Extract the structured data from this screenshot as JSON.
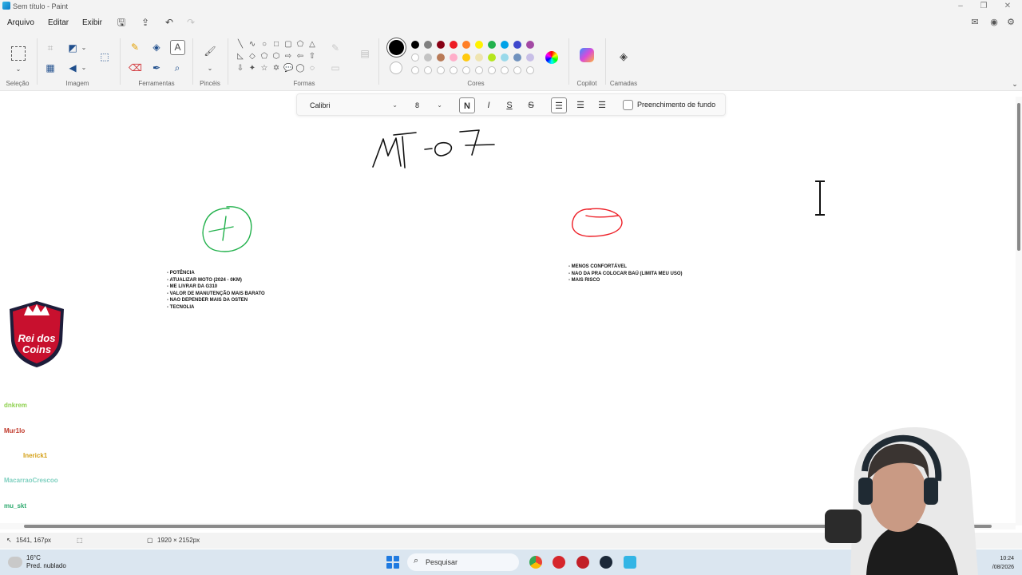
{
  "window": {
    "title": "Sem título - Paint"
  },
  "menu": {
    "items": [
      "Arquivo",
      "Editar",
      "Exibir"
    ]
  },
  "ribbon": {
    "groups": {
      "selecao": "Seleção",
      "imagem": "Imagem",
      "ferramentas": "Ferramentas",
      "pinceis": "Pincéis",
      "formas": "Formas",
      "cores": "Cores",
      "copilot": "Copilot",
      "camadas": "Camadas"
    },
    "colors": {
      "selected_primary": "#000000",
      "row1": [
        "#000000",
        "#7f7f7f",
        "#880015",
        "#ed1c24",
        "#ff7f27",
        "#fff200",
        "#22b14c",
        "#00a2e8",
        "#3f48cc",
        "#a349a4"
      ],
      "row2": [
        "#ffffff",
        "#c3c3c3",
        "#b97a57",
        "#ffaec9",
        "#ffc90e",
        "#efe4b0",
        "#b5e61d",
        "#99d9ea",
        "#7092be",
        "#c8bfe7"
      ]
    }
  },
  "text_toolbar": {
    "font": "Calibri",
    "size": "8",
    "bold_label": "N",
    "italic_label": "I",
    "underline_label": "S",
    "strike_label": "S",
    "fill_label": "Preenchimento de fundo"
  },
  "canvas": {
    "pros": [
      "- POTÊNCIA",
      "- ATUALIZAR MOTO (2024 - 0KM)",
      "- ME LIVRAR DA G310",
      "- VALOR DE MANUTENÇÃO MAIS BARATO",
      "- NAO DEPENDER MAIS DA OSTEN",
      "- TECNOLIA"
    ],
    "cons": [
      "- MENOS CONFORTÁVEL",
      "- NAO DA PRA COLOCAR BAÚ (LIMITA MEU USO)",
      "- MAIS RISCO"
    ]
  },
  "status": {
    "cursor_pos": "1541, 167px",
    "canvas_size": "1920 × 2152px"
  },
  "taskbar": {
    "temp": "16°C",
    "weather": "Pred. nublado",
    "search_placeholder": "Pesquisar",
    "time": "10:24",
    "date": "/08/2026"
  },
  "overlay": {
    "logo_text_1": "Rei dos",
    "logo_text_2": "Coins",
    "chat": [
      {
        "text": "dnkrem",
        "color": "#8fd14f"
      },
      {
        "text": "Mur1lo",
        "color": "#c0392b"
      },
      {
        "text": "Inerick1",
        "color": "#d4a017"
      },
      {
        "text": "MacarraoCrescoo",
        "color": "#7fd0c0"
      },
      {
        "text": "mu_skt",
        "color": "#2eaa6e"
      }
    ]
  }
}
